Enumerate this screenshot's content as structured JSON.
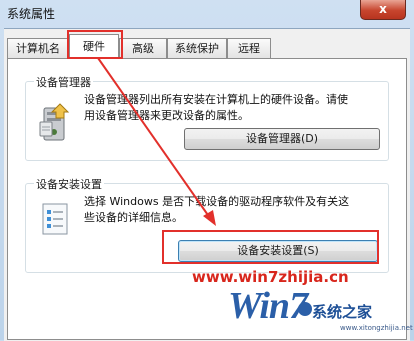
{
  "window": {
    "title": "系统属性",
    "close_glyph": "x"
  },
  "tabs": [
    {
      "label": "计算机名",
      "active": false
    },
    {
      "label": "硬件",
      "active": true
    },
    {
      "label": "高级",
      "active": false
    },
    {
      "label": "系统保护",
      "active": false
    },
    {
      "label": "远程",
      "active": false
    }
  ],
  "device_manager": {
    "group_title": "设备管理器",
    "description_line1": "设备管理器列出所有安装在计算机上的硬件设备。请使",
    "description_line2": "用设备管理器来更改设备的属性。",
    "button_label": "设备管理器(D)",
    "icon": "device-manager-icon"
  },
  "device_install": {
    "group_title": "设备安装设置",
    "description_line1": "选择 Windows 是否下载设备的驱动程序软件及有关这",
    "description_line2": "些设备的详细信息。",
    "button_label": "设备安装设置(S)",
    "icon": "checklist-icon"
  },
  "annotations": {
    "highlight_color": "#e2302b"
  },
  "watermark": {
    "url": "www.win7zhijia.cn",
    "logo_text": "Win7",
    "site_name": "系统之家",
    "small_url": "www.xitongzhijia.net"
  }
}
